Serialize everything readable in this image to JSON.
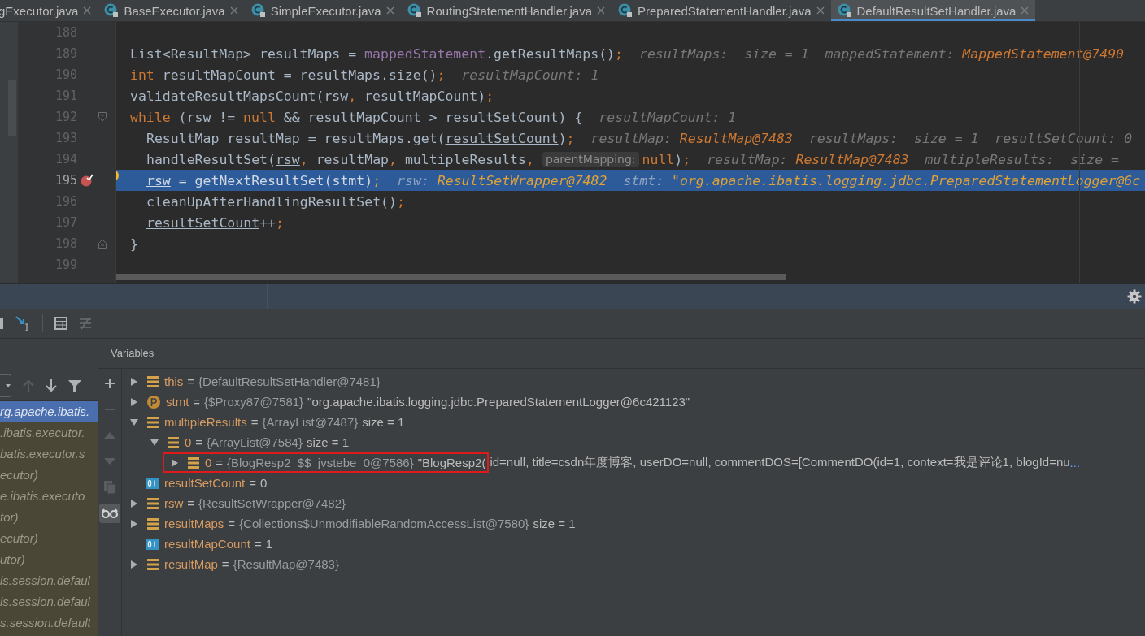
{
  "tabs": [
    {
      "label": "gExecutor.java",
      "selected": false,
      "class_icon": false
    },
    {
      "label": "BaseExecutor.java",
      "selected": false,
      "class_icon": true
    },
    {
      "label": "SimpleExecutor.java",
      "selected": false,
      "class_icon": true
    },
    {
      "label": "RoutingStatementHandler.java",
      "selected": false,
      "class_icon": true
    },
    {
      "label": "PreparedStatementHandler.java",
      "selected": false,
      "class_icon": true
    },
    {
      "label": "DefaultResultSetHandler.java",
      "selected": true,
      "class_icon": true
    }
  ],
  "code_lines": [
    {
      "number": "188",
      "current": false
    },
    {
      "number": "189",
      "nested": false,
      "current": false,
      "tokens": [
        {
          "kind": "plain",
          "text": "List<ResultMap> resultMaps = "
        },
        {
          "kind": "field",
          "text": "mappedStatement"
        },
        {
          "kind": "plain",
          "text": ".getResultMaps()"
        },
        {
          "kind": "punct",
          "text": ";"
        },
        {
          "kind": "hint",
          "text": "resultMaps:  size = 1  mappedStatement: "
        },
        {
          "kind": "hint_value",
          "text": "MappedStatement@7490"
        }
      ]
    },
    {
      "number": "190",
      "nested": false,
      "current": false,
      "tokens": [
        {
          "kind": "keyword",
          "text": "int"
        },
        {
          "kind": "plain",
          "text": " resultMapCount = resultMaps.size()"
        },
        {
          "kind": "punct",
          "text": ";"
        },
        {
          "kind": "hint",
          "text": "resultMapCount: 1"
        }
      ]
    },
    {
      "number": "191",
      "nested": false,
      "current": false,
      "tokens": [
        {
          "kind": "plain",
          "text": "validateResultMapsCount("
        },
        {
          "kind": "underlined",
          "text": "rsw"
        },
        {
          "kind": "punct",
          "text": ","
        },
        {
          "kind": "plain",
          "text": " resultMapCount)"
        },
        {
          "kind": "punct",
          "text": ";"
        }
      ]
    },
    {
      "number": "192",
      "nested": false,
      "current": false,
      "fold_start": true,
      "tokens": [
        {
          "kind": "keyword",
          "text": "while"
        },
        {
          "kind": "plain",
          "text": " ("
        },
        {
          "kind": "underlined",
          "text": "rsw"
        },
        {
          "kind": "plain",
          "text": " != "
        },
        {
          "kind": "keyword",
          "text": "null"
        },
        {
          "kind": "plain",
          "text": " && resultMapCount > "
        },
        {
          "kind": "underlined",
          "text": "resultSetCount"
        },
        {
          "kind": "plain",
          "text": ") {"
        },
        {
          "kind": "hint",
          "text": "resultMapCount: 1"
        }
      ]
    },
    {
      "number": "193",
      "nested": true,
      "current": false,
      "tokens": [
        {
          "kind": "plain",
          "text": "ResultMap resultMap = resultMaps.get("
        },
        {
          "kind": "underlined",
          "text": "resultSetCount"
        },
        {
          "kind": "plain",
          "text": ")"
        },
        {
          "kind": "punct",
          "text": ";"
        },
        {
          "kind": "hint",
          "text": "resultMap: "
        },
        {
          "kind": "hint_value",
          "text": "ResultMap@7483"
        },
        {
          "kind": "hint",
          "text": "resultMaps:  size = 1  resultSetCount: 0"
        }
      ]
    },
    {
      "number": "194",
      "nested": true,
      "current": false,
      "tokens": [
        {
          "kind": "plain",
          "text": "handleResultSet("
        },
        {
          "kind": "underlined",
          "text": "rsw"
        },
        {
          "kind": "punct",
          "text": ","
        },
        {
          "kind": "plain",
          "text": " resultMap"
        },
        {
          "kind": "punct",
          "text": ","
        },
        {
          "kind": "plain",
          "text": " multipleResults"
        },
        {
          "kind": "punct",
          "text": ","
        },
        {
          "kind": "param_hint",
          "text": "parentMapping:"
        },
        {
          "kind": "keyword",
          "text": "null"
        },
        {
          "kind": "plain",
          "text": ")"
        },
        {
          "kind": "punct",
          "text": ";"
        },
        {
          "kind": "hint",
          "text": "resultMap: "
        },
        {
          "kind": "hint_value",
          "text": "ResultMap@7483"
        },
        {
          "kind": "hint",
          "text": "multipleResults:  size ="
        }
      ]
    },
    {
      "number": "195",
      "nested": true,
      "current": true,
      "breakpoint": true,
      "bulb": true,
      "tokens": [
        {
          "kind": "underlined",
          "text": "rsw"
        },
        {
          "kind": "plain",
          "text": " = getNextResultSet(stmt)"
        },
        {
          "kind": "punct",
          "text": ";"
        },
        {
          "kind": "hint",
          "text": "rsw: "
        },
        {
          "kind": "hint_value",
          "text": "ResultSetWrapper@7482"
        },
        {
          "kind": "hint",
          "text": "stmt: "
        },
        {
          "kind": "hint_value",
          "text": "\"org.apache.ibatis.logging.jdbc.PreparedStatementLogger@6c"
        }
      ]
    },
    {
      "number": "196",
      "nested": true,
      "current": false,
      "tokens": [
        {
          "kind": "plain",
          "text": "cleanUpAfterHandlingResultSet()"
        },
        {
          "kind": "punct",
          "text": ";"
        }
      ]
    },
    {
      "number": "197",
      "nested": true,
      "current": false,
      "tokens": [
        {
          "kind": "underlined",
          "text": "resultSetCount"
        },
        {
          "kind": "plain",
          "text": "++"
        },
        {
          "kind": "punct",
          "text": ";"
        }
      ]
    },
    {
      "number": "198",
      "nested": false,
      "current": false,
      "fold_end": true,
      "tokens": [
        {
          "kind": "plain",
          "text": "}"
        }
      ]
    },
    {
      "number": "199",
      "current": false
    }
  ],
  "frames": [
    {
      "label": "rg.apache.ibatis.",
      "selected": true
    },
    {
      "label": ".ibatis.executor.",
      "selected": false
    },
    {
      "label": "batis.executor.s",
      "selected": false
    },
    {
      "label": "ecutor)",
      "selected": false
    },
    {
      "label": "e.ibatis.executo",
      "selected": false
    },
    {
      "label": "tor)",
      "selected": false
    },
    {
      "label": "ecutor)",
      "selected": false
    },
    {
      "label": "utor)",
      "selected": false
    },
    {
      "label": "is.session.defaul",
      "selected": false
    },
    {
      "label": "is.session.defaul",
      "selected": false
    },
    {
      "label": "s.session.default",
      "selected": false
    }
  ],
  "variables_title": "Variables",
  "watch_tools": [
    {
      "kind": "add",
      "disabled": false,
      "selected": false
    },
    {
      "kind": "remove",
      "disabled": true,
      "selected": false
    },
    {
      "kind": "up",
      "disabled": true,
      "selected": false
    },
    {
      "kind": "down",
      "disabled": true,
      "selected": false
    },
    {
      "kind": "copy",
      "disabled": true,
      "selected": false
    },
    {
      "kind": "glasses",
      "disabled": false,
      "selected": true
    }
  ],
  "variables": [
    {
      "kind": "field",
      "expanded": false,
      "name": "this",
      "equals": "=",
      "ref": "{DefaultResultSetHandler@7481}"
    },
    {
      "kind": "param",
      "expanded": false,
      "name": "stmt",
      "equals": "=",
      "ref": "{$Proxy87@7581}",
      "value": "\"org.apache.ibatis.logging.jdbc.PreparedStatementLogger@6c421123\""
    },
    {
      "kind": "field",
      "expanded": true,
      "name": "multipleResults",
      "equals": "=",
      "ref": "{ArrayList@7487}",
      "value": "size = 1",
      "children": [
        {
          "kind": "field",
          "expanded": true,
          "name": "0",
          "equals": "=",
          "ref": "{ArrayList@7584}",
          "value": "size = 1",
          "children": [
            {
              "kind": "field",
              "expanded": false,
              "highlighted": true,
              "name": "0",
              "equals": "=",
              "ref": "{BlogResp2_$$_jvstebe_0@7586}",
              "value": "\"BlogResp2(",
              "value_more": "id=null, title=csdn年度博客, userDO=null, commentDOS=[CommentDO(id=1, context=我是评论1, blogId=nu",
              "ellipsis": "..."
            }
          ]
        }
      ]
    },
    {
      "kind": "primitive",
      "name": "resultSetCount",
      "equals": "=",
      "value": "0"
    },
    {
      "kind": "field",
      "expanded": false,
      "name": "rsw",
      "equals": "=",
      "ref": "{ResultSetWrapper@7482}"
    },
    {
      "kind": "field",
      "expanded": false,
      "name": "resultMaps",
      "equals": "=",
      "ref": "{Collections$UnmodifiableRandomAccessList@7580}",
      "value": "size = 1"
    },
    {
      "kind": "primitive",
      "name": "resultMapCount",
      "equals": "=",
      "value": "1"
    },
    {
      "kind": "field",
      "expanded": false,
      "name": "resultMap",
      "equals": "=",
      "ref": "{ResultMap@7483}"
    }
  ]
}
